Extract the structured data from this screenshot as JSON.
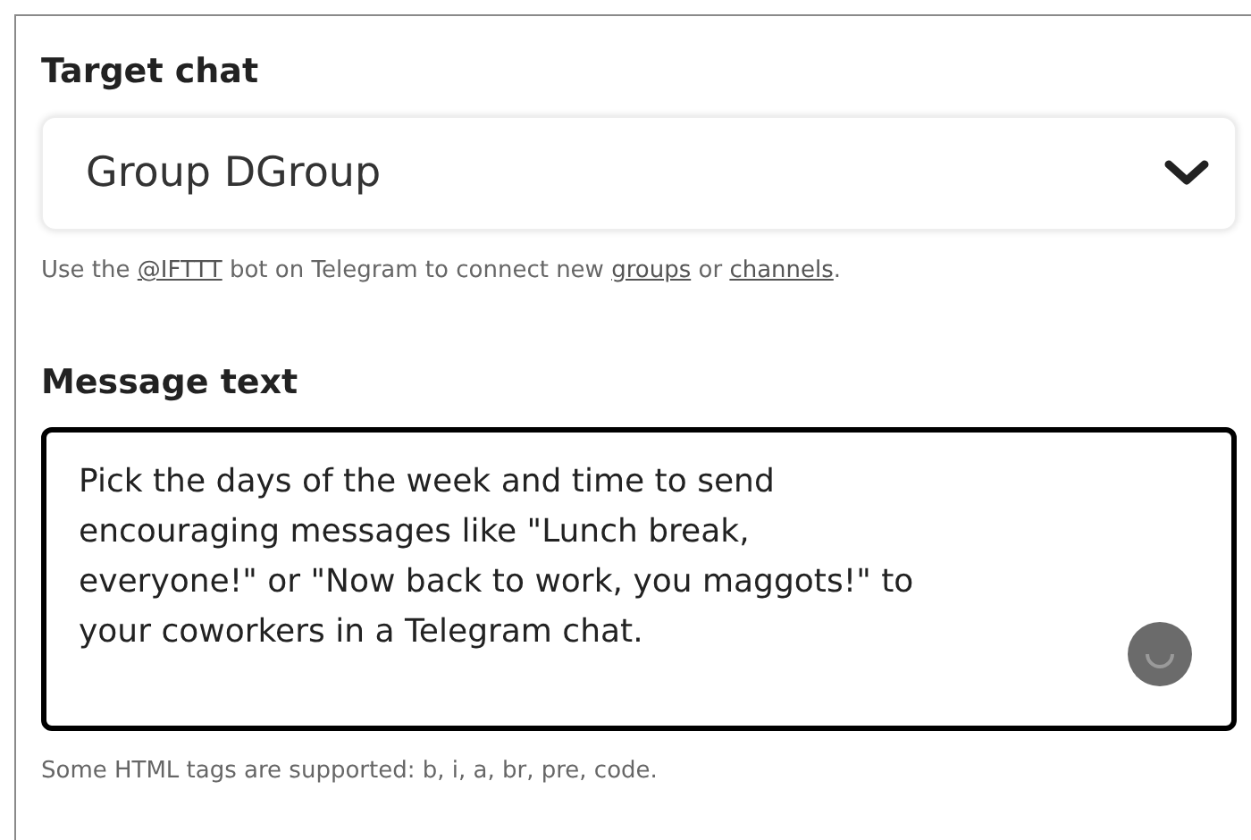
{
  "target_chat": {
    "label": "Target chat",
    "value": "Group DGroup",
    "help": [
      {
        "kind": "text",
        "text": "Use the "
      },
      {
        "kind": "link",
        "text": "@IFTTT"
      },
      {
        "kind": "text",
        "text": " bot on Telegram to connect new "
      },
      {
        "kind": "link",
        "text": "groups"
      },
      {
        "kind": "text",
        "text": " or "
      },
      {
        "kind": "link",
        "text": "channels"
      },
      {
        "kind": "text",
        "text": "."
      }
    ]
  },
  "message_text": {
    "label": "Message text",
    "value": "Pick the days of the week and time to send encouraging messages like \"Lunch break, everyone!\" or \"Now back to work, you maggots!\" to your coworkers in a Telegram chat.",
    "help": "Some HTML tags are supported: b, i, a, br, pre, code."
  }
}
